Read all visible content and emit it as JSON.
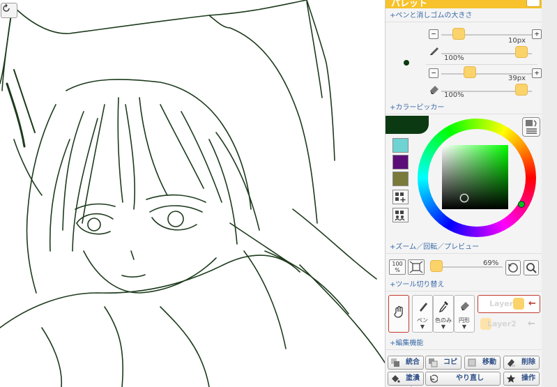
{
  "canvas": {
    "redo_icon": "rotate-cw-icon"
  },
  "palette": {
    "title": "パレット",
    "sections": {
      "brush_size": "+ペンと消しゴムの大きさ",
      "color_picker": "+カラーピッカー",
      "zoom": "+ズーム／回転／プレビュー",
      "tool_switch": "+ツール切り替え",
      "edit": "+編集機能"
    },
    "pen": {
      "size_label": "10px",
      "opacity_label": "100%",
      "size_fraction": 0.1,
      "opacity_fraction": 1.0
    },
    "eraser": {
      "size_label": "39px",
      "opacity_label": "100%",
      "size_fraction": 0.18,
      "opacity_fraction": 1.0
    },
    "minus_label": "−",
    "plus_label": "+",
    "colors": {
      "current": "#0b3a12",
      "swatches": [
        "#6fd3d3",
        "#5b0e78",
        "#7a7a3a"
      ]
    },
    "zoom": {
      "percent_label": "69%",
      "fraction": 0.69,
      "reset_label": "100",
      "reset_sub": "%"
    },
    "tools": [
      {
        "name": "hand",
        "label": ""
      },
      {
        "name": "pen",
        "label": "ペン"
      },
      {
        "name": "eyedropper",
        "label": "色のみ"
      },
      {
        "name": "eraser",
        "label": "円形"
      }
    ],
    "tool_arrow": "▼",
    "layers": [
      {
        "label": "Layer1",
        "active": true
      },
      {
        "label": "Layer2",
        "active": false
      }
    ],
    "edit_buttons": [
      {
        "label": "統合",
        "icon": "merge-icon"
      },
      {
        "label": "コピー",
        "icon": "copy-icon"
      },
      {
        "label": "移動",
        "icon": "move-icon"
      },
      {
        "label": "削除",
        "icon": "delete-icon"
      },
      {
        "label": "塗潰し",
        "icon": "fill-bucket-icon"
      },
      {
        "label": "やり直し",
        "icon": "undo-icon"
      },
      {
        "label": "操作",
        "icon": "star-icon"
      }
    ]
  }
}
